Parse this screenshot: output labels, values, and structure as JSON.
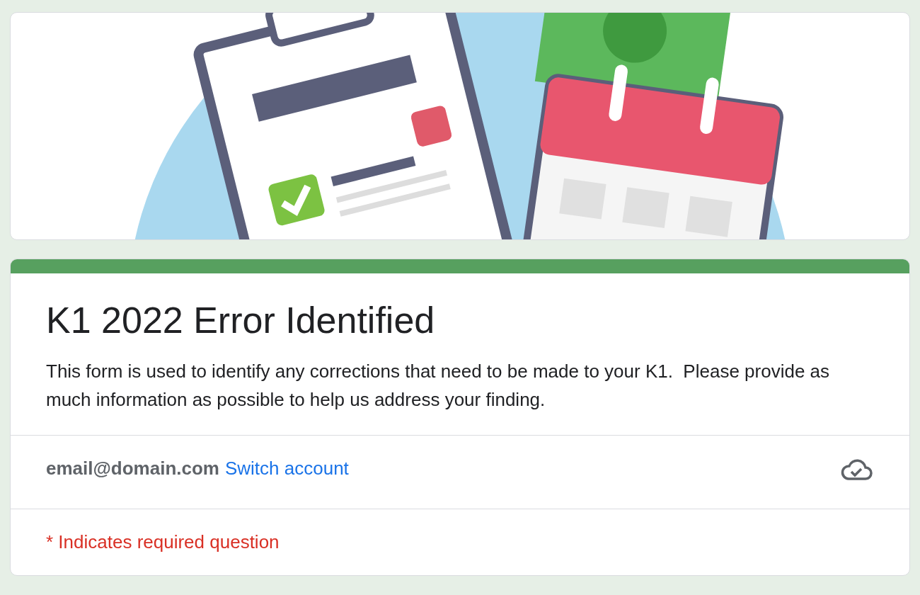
{
  "form": {
    "title": "K1 2022 Error Identified",
    "description": "This form is used to identify any corrections that need to be made to your K1.  Please provide as much information as possible to help us address your finding.",
    "account": {
      "email": "email@domain.com",
      "switch_link": "Switch account"
    },
    "required_note": "* Indicates required question"
  }
}
